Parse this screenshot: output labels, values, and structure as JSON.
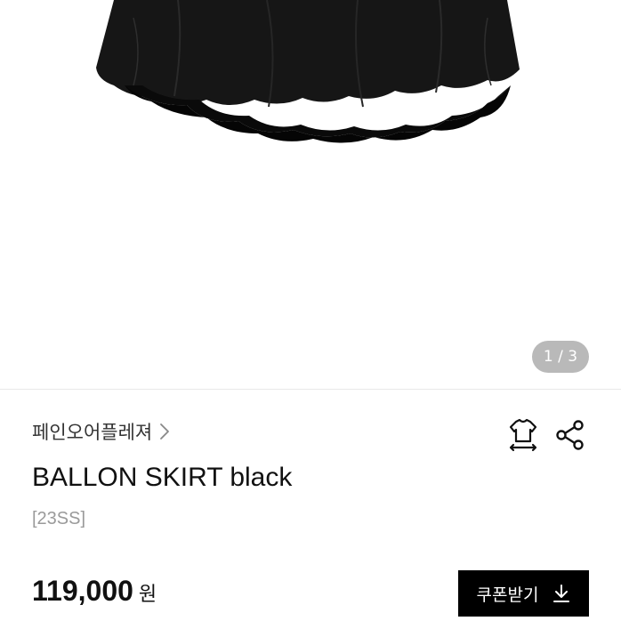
{
  "gallery": {
    "image_alt": "black chiffon ballon skirt",
    "current_page": "1",
    "total_pages": "3",
    "indicator_text": "1 / 3"
  },
  "product": {
    "brand": "페인오어플레져",
    "title": "BALLON SKIRT black",
    "season": "[23SS]",
    "price": "119,000",
    "currency": "원"
  },
  "actions": {
    "coupon_label": "쿠폰받기",
    "icons": [
      "chevron-right-icon",
      "fit-size-icon",
      "share-icon",
      "download-icon"
    ]
  },
  "colors": {
    "accent": "#000000",
    "muted_text": "#9a9a9a",
    "indicator_bg": "#b9b9b9"
  }
}
